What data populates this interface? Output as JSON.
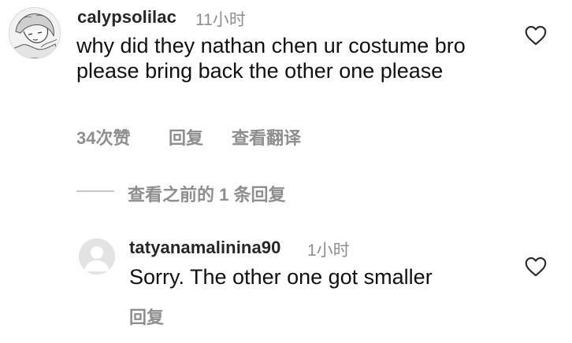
{
  "comment": {
    "username": "calypsolilac",
    "time": "11小时",
    "text": "why did they nathan chen ur costume bro please bring back the other one please",
    "likes": "34次赞",
    "reply_label": "回复",
    "translate_label": "查看翻译",
    "avatar_icon": "anime-sketch-avatar",
    "like_icon": "heart-outline"
  },
  "replies_toggle": {
    "label": "查看之前的 1 条回复"
  },
  "reply": {
    "username": "tatyanamalinina90",
    "time": "1小时",
    "text": "Sorry. The other one got smaller",
    "reply_label": "回复",
    "avatar_icon": "default-user-avatar",
    "like_icon": "heart-outline"
  },
  "colors": {
    "secondary_text": "#8e8e8e",
    "username": "#262626",
    "body_text": "#111111",
    "divider": "#c7c7c7"
  }
}
